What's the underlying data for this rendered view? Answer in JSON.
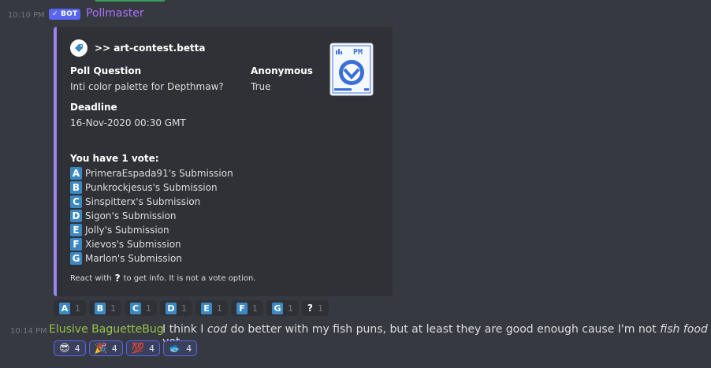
{
  "message1": {
    "timestamp": "10:10 PM",
    "bot_badge": "✓ BOT",
    "author": "Pollmaster",
    "embed": {
      "author_name": ">> art-contest.betta",
      "thumbnail_label": "PM",
      "fields": {
        "poll_question_name": "Poll Question",
        "poll_question_value": "Inti color palette for Depthmaw?",
        "anonymous_name": "Anonymous",
        "anonymous_value": "True",
        "deadline_name": "Deadline",
        "deadline_value": "16-Nov-2020 00:30 GMT"
      },
      "votes_title": "You have 1 vote:",
      "options": [
        {
          "letter": "A",
          "label": "PrimeraEspada91's Submission"
        },
        {
          "letter": "B",
          "label": "Punkrockjesus's Submission"
        },
        {
          "letter": "C",
          "label": "Sinspitterx's Submission"
        },
        {
          "letter": "D",
          "label": "Sigon's Submission"
        },
        {
          "letter": "E",
          "label": "Jolly's Submission"
        },
        {
          "letter": "F",
          "label": "Xievos's Submission"
        },
        {
          "letter": "G",
          "label": "Marlon's Submission"
        }
      ],
      "footer_before": "React with",
      "footer_symbol": "?",
      "footer_after": "to get info. It is not a vote option."
    },
    "reactions": [
      {
        "emoji": "A",
        "count": "1"
      },
      {
        "emoji": "B",
        "count": "1"
      },
      {
        "emoji": "C",
        "count": "1"
      },
      {
        "emoji": "D",
        "count": "1"
      },
      {
        "emoji": "E",
        "count": "1"
      },
      {
        "emoji": "F",
        "count": "1"
      },
      {
        "emoji": "G",
        "count": "1"
      },
      {
        "emoji": "?",
        "count": "1"
      }
    ]
  },
  "message2": {
    "timestamp": "10:14 PM",
    "author": "Elusive BaguetteBug",
    "text_1": "I think I ",
    "text_italic_1": "cod",
    "text_2": " do better with my fish puns, but at least they are good enough cause I'm not ",
    "text_italic_2": "fish food",
    "text_3": " yet",
    "reactions": [
      {
        "emoji": "😎",
        "count": "4"
      },
      {
        "emoji": "🎉",
        "count": "4"
      },
      {
        "emoji": "💯",
        "count": "4"
      },
      {
        "emoji": "🐟",
        "count": "4"
      }
    ]
  },
  "colors": {
    "background": "#36393f",
    "embed_bg": "#2f3136",
    "embed_border": "#9b84ee",
    "bot_badge": "#5865f2",
    "pollmaster_name": "#a970ff",
    "baguette_name": "#99c34b",
    "letter_box": "#3b88c3"
  }
}
